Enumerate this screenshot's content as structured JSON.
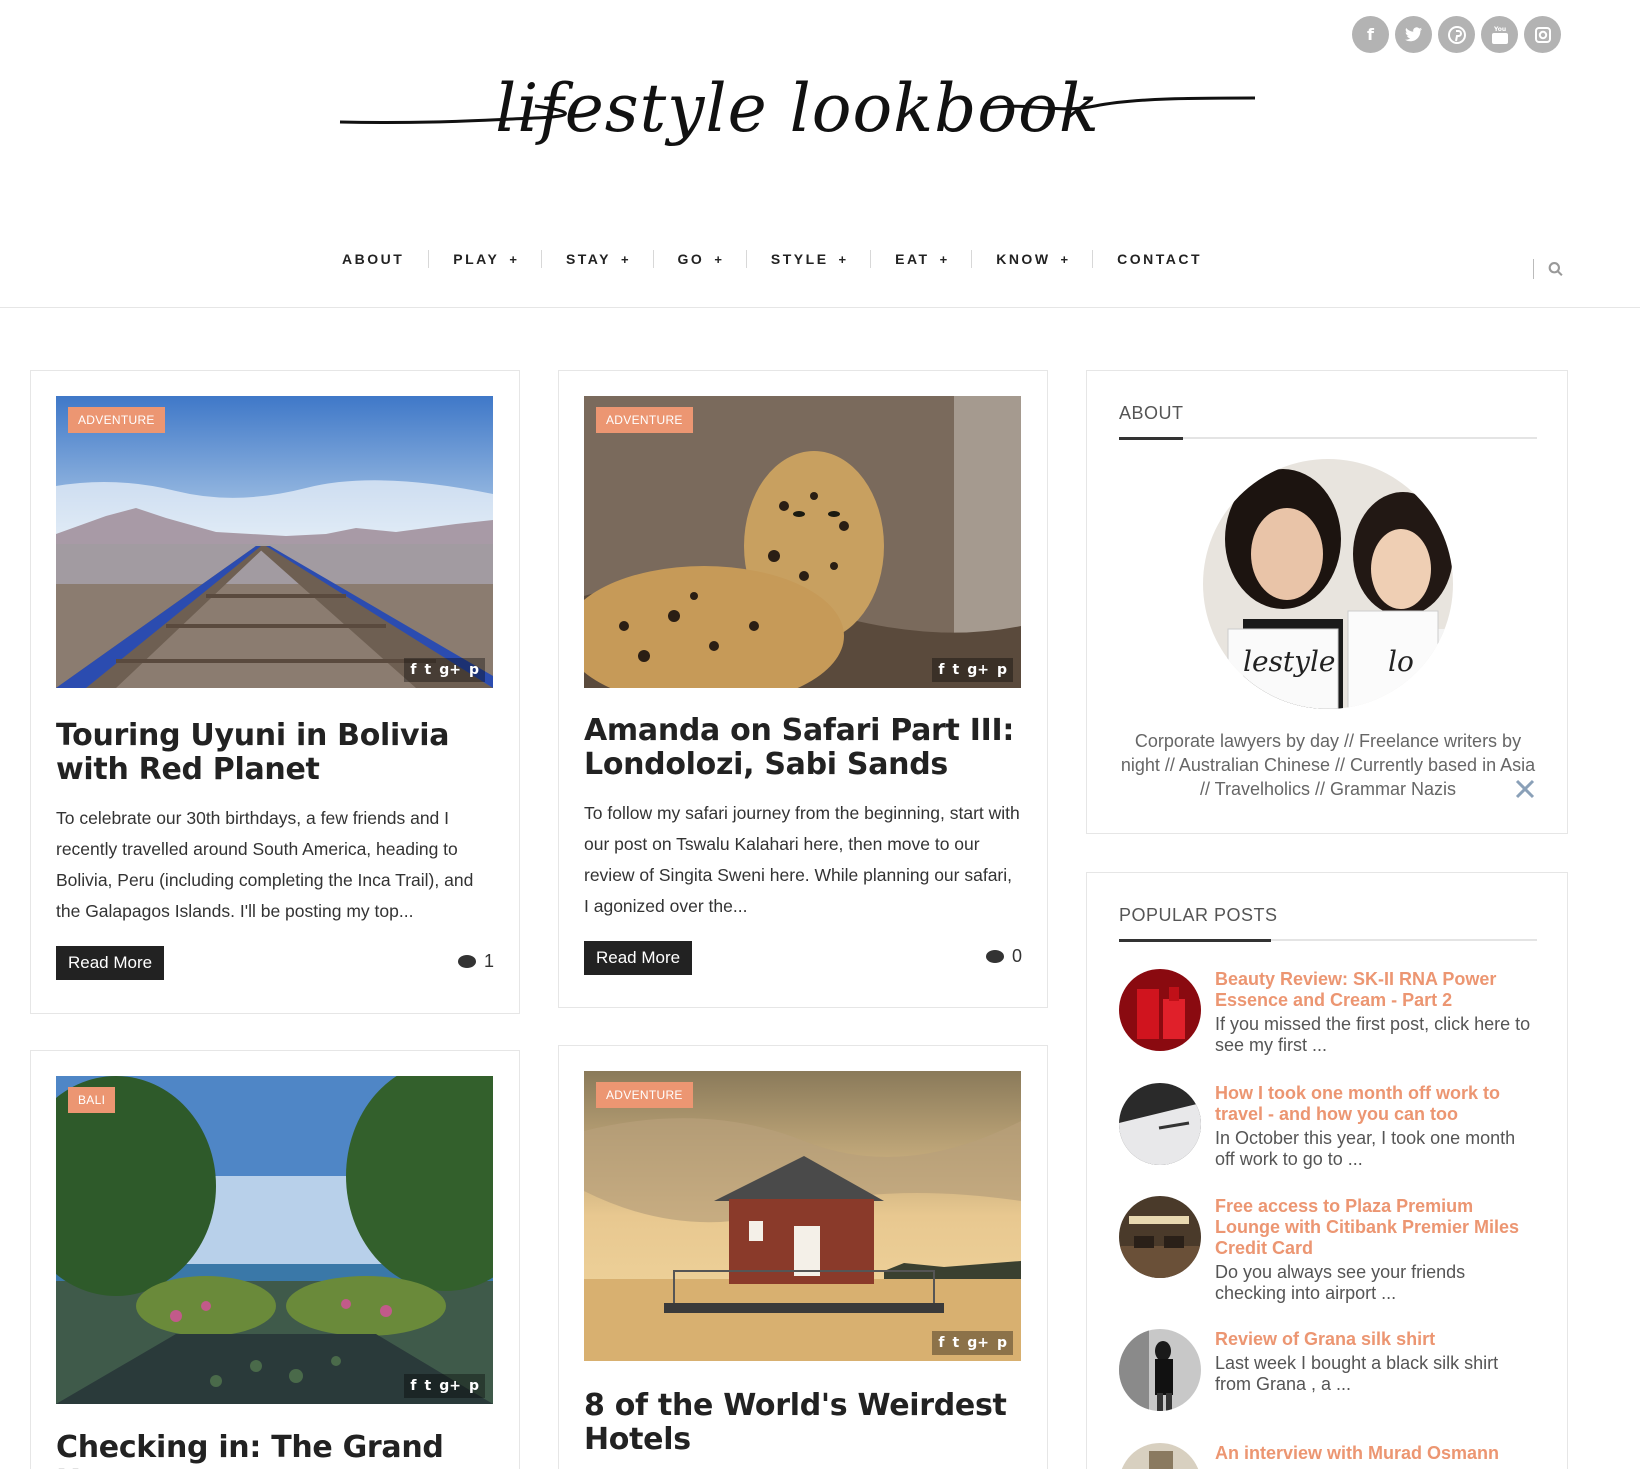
{
  "brand": {
    "logo_text": "lifestyle lookbook"
  },
  "social": [
    "f",
    "t",
    "p",
    "yt",
    "ig"
  ],
  "nav": {
    "items": [
      {
        "label": "ABOUT",
        "has_sub": false
      },
      {
        "label": "PLAY",
        "has_sub": true
      },
      {
        "label": "STAY",
        "has_sub": true
      },
      {
        "label": "GO",
        "has_sub": true
      },
      {
        "label": "STYLE",
        "has_sub": true
      },
      {
        "label": "EAT",
        "has_sub": true
      },
      {
        "label": "KNOW",
        "has_sub": true
      },
      {
        "label": "CONTACT",
        "has_sub": false
      }
    ],
    "plus": "+"
  },
  "posts": [
    {
      "tag": "ADVENTURE",
      "title": "Touring Uyuni in Bolivia with Red Planet",
      "excerpt": "To celebrate our 30th birthdays, a few friends and I recently travelled around South America, heading to Bolivia, Peru (including completing the Inca Trail), and the Galapagos Islands. I'll be posting my top...",
      "read_more": "Read More",
      "comments": "1"
    },
    {
      "tag": "ADVENTURE",
      "title": "Amanda on Safari Part III: Londolozi, Sabi Sands",
      "excerpt": "To follow my safari journey from the beginning, start with our post on Tswalu Kalahari here, then move to our review of Singita Sweni here. While planning our safari, I agonized over the...",
      "read_more": "Read More",
      "comments": "0"
    },
    {
      "tag": "BALI",
      "title": "Checking in: The Grand Hyatt,"
    },
    {
      "tag": "ADVENTURE",
      "title": "8 of the World's Weirdest Hotels"
    }
  ],
  "share_icons": [
    "f",
    "t",
    "g+",
    "p"
  ],
  "sidebar": {
    "about": {
      "title": "ABOUT",
      "text": "Corporate lawyers by day // Freelance writers by night // Australian Chinese // Currently based in Asia // Travelholics // Grammar Nazis",
      "photo_sign_left": "lestyle",
      "photo_sign_right": "lo"
    },
    "popular": {
      "title": "POPULAR POSTS",
      "items": [
        {
          "title": "Beauty Review: SK-II RNA Power Essence and Cream - Part 2",
          "desc": "If you missed the first post, click here  to see my first ..."
        },
        {
          "title": "How I took one month off work to travel - and how you can too",
          "desc": "In October this year, I took one month off work to go to ..."
        },
        {
          "title": "Free access to Plaza Premium Lounge with Citibank Premier Miles Credit Card",
          "desc": "Do you always see your friends checking into airport ..."
        },
        {
          "title": "Review of Grana silk shirt",
          "desc": "Last week I bought a black silk shirt from Grana , a ..."
        },
        {
          "title": "An interview with Murad Osmann",
          "desc": ""
        }
      ]
    }
  }
}
